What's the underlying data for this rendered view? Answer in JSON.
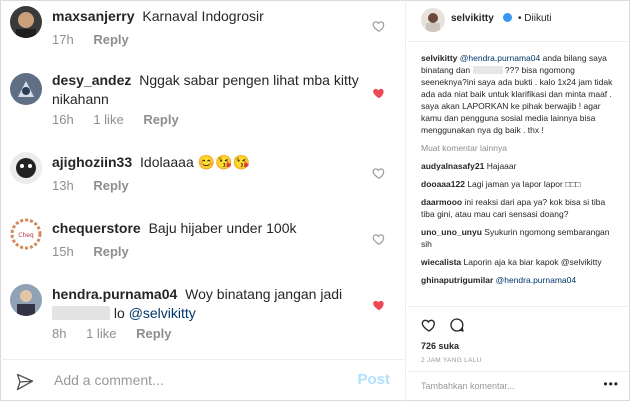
{
  "comments": [
    {
      "user": "maxsanjerry",
      "text": "Karnaval Indogrosir",
      "time": "17h",
      "likes": "",
      "reply": "Reply",
      "liked": false
    },
    {
      "user": "desy_andez",
      "text": "Nggak sabar pengen lihat mba kitty nikahann",
      "time": "16h",
      "likes": "1 like",
      "reply": "Reply",
      "liked": true
    },
    {
      "user": "ajighoziin33",
      "text": "Idolaaaa 😊😘😘",
      "time": "13h",
      "likes": "",
      "reply": "Reply",
      "liked": false
    },
    {
      "user": "chequerstore",
      "text": "Baju hijaber under 100k",
      "time": "15h",
      "likes": "",
      "reply": "Reply",
      "liked": false
    },
    {
      "user": "hendra.purnama04",
      "text": "Woy binatang jangan jadi",
      "text2": "lo",
      "mention": "@selvikitty",
      "time": "8h",
      "likes": "1 like",
      "reply": "Reply",
      "liked": true
    }
  ],
  "add_comment": {
    "placeholder": "Add a comment...",
    "post": "Post"
  },
  "post_panel": {
    "username": "selvikitty",
    "follow": "• Diikuti",
    "caption_user": "selvikitty",
    "caption_mention": "@hendra.purnama04",
    "caption_a": "anda bilang saya binatang dan",
    "caption_b": "??? bisa ngomong seeneknya?ini saya ada bukti . kalo 1x24 jam tidak ada ada niat baik untuk klarifikasi dan minta maaf . saya akan LAPORKAN ke pihak berwajib ! agar kamu dan pengguna sosial media lainnya bisa menggunakan nya dg baik . thx !",
    "more_comments": "Muat komentar lainnya",
    "comments": [
      {
        "user": "audyalnasafy21",
        "text": "Hajaaar"
      },
      {
        "user": "dooaaa122",
        "text": "Lagi jaman ya lapor lapor □□□"
      },
      {
        "user": "daarmooo",
        "text": "ini reaksi dari apa ya? kok bisa si tiba tiba gini, atau mau cari sensasi doang?"
      },
      {
        "user": "uno_uno_unyu",
        "text": "Syukurin ngomong sembarangan sih"
      },
      {
        "user": "wiecalista",
        "text": "Laporin aja ka biar kapok @selvikitty"
      },
      {
        "user": "ghinaputrigumilar",
        "text": "@hendra.purnama04"
      }
    ],
    "likes": "726 suka",
    "time": "2 JAM YANG LALU",
    "add_placeholder": "Tambahkan komentar..."
  }
}
